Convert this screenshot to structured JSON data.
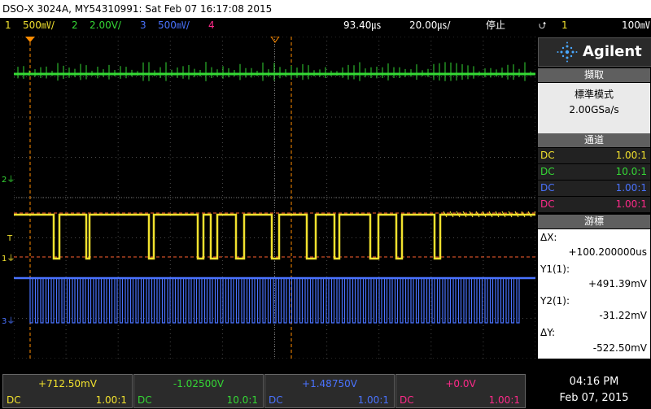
{
  "title": "DSO-X 3024A, MY54310991: Sat Feb 07 16:17:08 2015",
  "status": {
    "ch1": {
      "num": "1",
      "scale": "500㎷/"
    },
    "ch2": {
      "num": "2",
      "scale": "2.00V/"
    },
    "ch3": {
      "num": "3",
      "scale": "500㎷/"
    },
    "ch4": {
      "num": "4"
    },
    "time_offset": "93.40㎲",
    "timebase": "20.00㎲/",
    "run_state": "停止",
    "trigger_icon": "rising-edge-icon",
    "trigger_source": "1",
    "trigger_level": "100㎷"
  },
  "colors": {
    "ch1": "#f2e22e",
    "ch2": "#35d935",
    "ch3": "#4a73ff",
    "ch4": "#ff2a8a"
  },
  "brand": "Agilent",
  "acquisition": {
    "header": "擷取",
    "mode": "標準模式",
    "rate": "2.00GSa/s"
  },
  "channels": {
    "header": "通道",
    "rows": [
      {
        "coupling": "DC",
        "probe": "1.00:1"
      },
      {
        "coupling": "DC",
        "probe": "10.0:1"
      },
      {
        "coupling": "DC",
        "probe": "1.00:1"
      },
      {
        "coupling": "DC",
        "probe": "1.00:1"
      }
    ]
  },
  "cursors": {
    "header": "游標",
    "dx_label": "ΔX:",
    "dx_value": "+100.200000us",
    "y1_label": "Y1(1):",
    "y1_value": "+491.39mV",
    "y2_label": "Y2(1):",
    "y2_value": "-31.22mV",
    "dy_label": "ΔY:",
    "dy_value": "-522.50mV"
  },
  "screen_markers": {
    "ch2": "2",
    "ch1": "1",
    "ch3": "3",
    "trigger": "T"
  },
  "bottom": [
    {
      "value": "+712.50mV",
      "coupling": "DC",
      "probe": "1.00:1"
    },
    {
      "value": "-1.02500V",
      "coupling": "DC",
      "probe": "10.0:1"
    },
    {
      "value": "+1.48750V",
      "coupling": "DC",
      "probe": "1.00:1"
    },
    {
      "value": "+0.0V",
      "coupling": "DC",
      "probe": "1.00:1"
    }
  ],
  "clock": {
    "time": "04:16 PM",
    "date": "Feb 07, 2015"
  }
}
